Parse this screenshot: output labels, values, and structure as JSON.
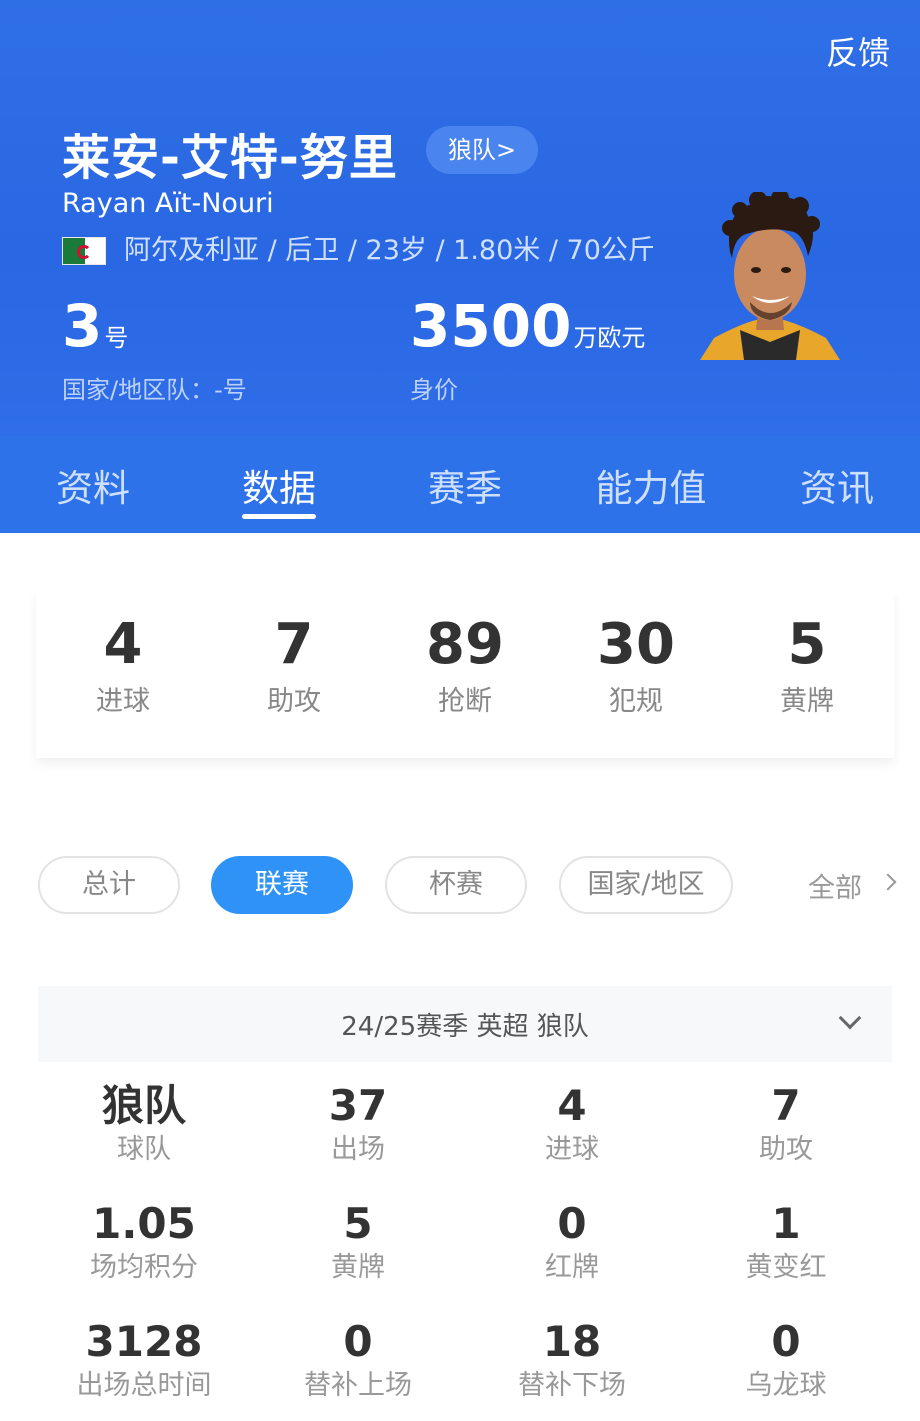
{
  "header": {
    "feedback": "反馈",
    "name_cn": "莱安-艾特-努里",
    "team_pill": "狼队>",
    "name_en": "Rayan Aït-Nouri",
    "meta": "阿尔及利亚 / 后卫 / 23岁 / 1.80米 / 70公斤",
    "shirt_number": "3",
    "shirt_suffix": "号",
    "national_team": "国家/地区队：-号",
    "market_value": "3500",
    "market_value_unit": "万欧元",
    "market_value_label": "身价"
  },
  "tabs": [
    "资料",
    "数据",
    "赛季",
    "能力值",
    "资讯"
  ],
  "active_tab": "数据",
  "summary": [
    {
      "value": "4",
      "label": "进球"
    },
    {
      "value": "7",
      "label": "助攻"
    },
    {
      "value": "89",
      "label": "抢断"
    },
    {
      "value": "30",
      "label": "犯规"
    },
    {
      "value": "5",
      "label": "黄牌"
    }
  ],
  "filters": [
    "总计",
    "联赛",
    "杯赛",
    "国家/地区"
  ],
  "active_filter": "联赛",
  "all_label": "全部",
  "season": "24/25赛季 英超 狼队",
  "grid": [
    [
      {
        "value": "狼队",
        "label": "球队"
      },
      {
        "value": "37",
        "label": "出场"
      },
      {
        "value": "4",
        "label": "进球"
      },
      {
        "value": "7",
        "label": "助攻"
      }
    ],
    [
      {
        "value": "1.05",
        "label": "场均积分"
      },
      {
        "value": "5",
        "label": "黄牌"
      },
      {
        "value": "0",
        "label": "红牌"
      },
      {
        "value": "1",
        "label": "黄变红"
      }
    ],
    [
      {
        "value": "3128",
        "label": "出场总时间"
      },
      {
        "value": "0",
        "label": "替补上场"
      },
      {
        "value": "18",
        "label": "替补下场"
      },
      {
        "value": "0",
        "label": "乌龙球"
      }
    ]
  ],
  "colors": {
    "header_blue": "#2f6fe6",
    "pill_blue": "#2f92f7"
  }
}
